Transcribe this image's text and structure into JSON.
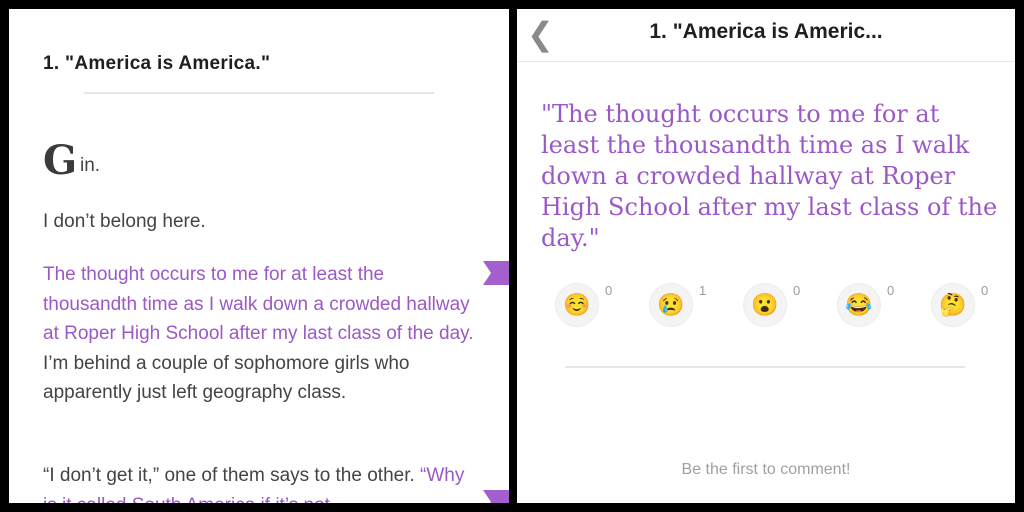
{
  "left": {
    "chapter_title": "1. \"America is America.\"",
    "dropcap_letter": "G",
    "dropcap_rest": "in.",
    "para1": "I don’t belong here.",
    "para2_highlight": "The thought occurs to me for at least the thousandth time as I walk down a crowded hallway at Roper High School after my last class of the day.",
    "para2_rest": " I’m behind a couple of sophomore girls who apparently just left geography class.",
    "para3_text": "“I don’t get it,” one of them says to the other.",
    "para3_highlight": "“Why is it called South America if it’s not"
  },
  "right": {
    "title": "1. \"America is Americ...",
    "back_icon": "chevron-left-icon",
    "quote": "\"The thought occurs to me for at least the thousandth time as I walk down a crowded hallway at Roper High School after my last class of the day.\"",
    "reactions": [
      {
        "emoji": "☺️",
        "icon": "smiling-face-icon",
        "count": "0"
      },
      {
        "emoji": "😢",
        "icon": "crying-face-icon",
        "count": "1"
      },
      {
        "emoji": "😮",
        "icon": "surprised-face-icon",
        "count": "0"
      },
      {
        "emoji": "😂",
        "icon": "laughing-face-icon",
        "count": "0"
      },
      {
        "emoji": "🤔",
        "icon": "thinking-face-icon",
        "count": "0"
      }
    ],
    "comment_prompt": "Be the first to comment!"
  },
  "colors": {
    "accent": "#9b59c5",
    "marker": "#a45fcf",
    "text": "#444444"
  }
}
